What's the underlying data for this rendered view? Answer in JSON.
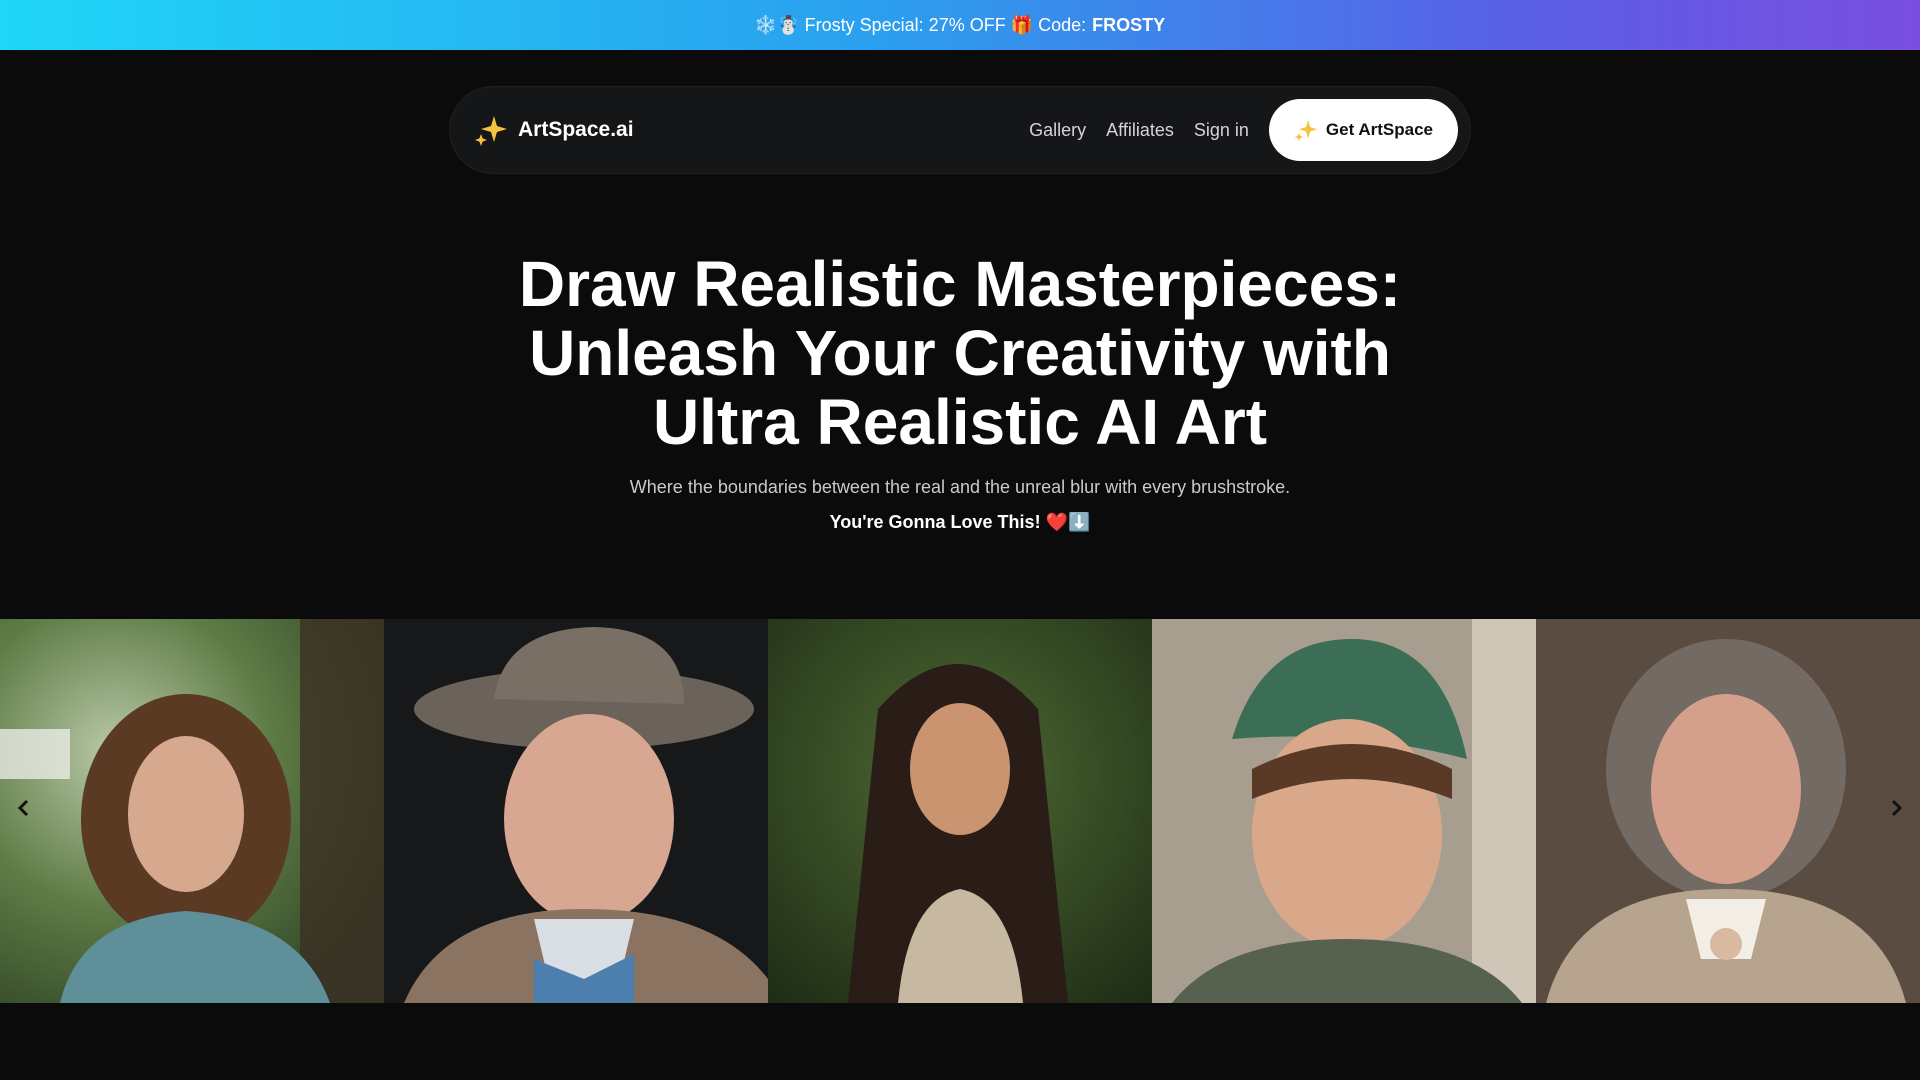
{
  "promo": {
    "text": "❄️☃️ Frosty Special: 27% OFF 🎁 Code:",
    "code": "FROSTY"
  },
  "nav": {
    "brand": "ArtSpace.ai",
    "brand_icon": "sparkles-icon",
    "links": [
      "Gallery",
      "Affiliates",
      "Sign in"
    ],
    "cta_label": "Get ArtSpace"
  },
  "hero": {
    "title": "Draw Realistic Masterpieces: Unleash Your Creativity with Ultra Realistic AI Art",
    "subtitle": "Where the boundaries between the real and the unreal blur with every brushstroke.",
    "tagline": "You're Gonna Love This! ❤️⬇️"
  },
  "gallery": {
    "images": [
      "woman-curly-hair-portrait",
      "elderly-man-hat-bowtie-portrait",
      "young-woman-long-hair-portrait",
      "boy-green-cap-portrait",
      "elderly-woman-cardigan-portrait"
    ],
    "prev_icon": "chevron-left-icon",
    "next_icon": "chevron-right-icon"
  },
  "colors": {
    "background": "#0b0b0c",
    "nav_bg": "#151618",
    "cta_bg": "#ffffff",
    "promo_gradient_start": "#1fd6f7",
    "promo_gradient_end": "#7a4fe0"
  }
}
